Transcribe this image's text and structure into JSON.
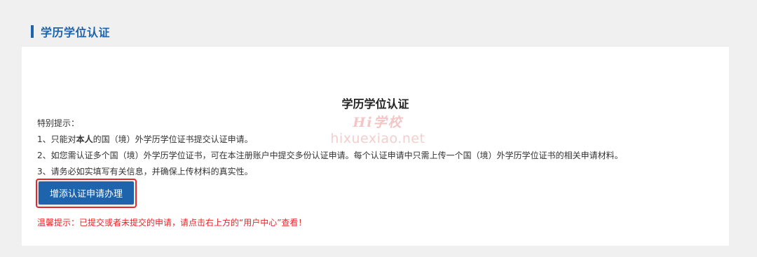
{
  "section": {
    "title": "学历学位认证"
  },
  "card": {
    "title": "学历学位认证",
    "watermark": {
      "logo": "Hi学校",
      "site": "hixuexiao.net"
    },
    "tips": {
      "heading": "特别提示：",
      "item1_prefix": "1、只能对",
      "item1_bold": "本人",
      "item1_suffix": "的国（境）外学历学位证书提交认证申请。",
      "item2": "2、如您需认证多个国（境）外学历学位证书，可在本注册账户中提交多份认证申请。每个认证申请中只需上传一个国（境）外学历学位证书的相关申请材料。",
      "item3": "3、请务必如实填写有关信息，并确保上传材料的真实性。"
    },
    "apply_button": "增添认证申请办理",
    "warm_tip": "温馨提示：已提交或者未提交的申请，请点击右上方的“用户中心”查看！"
  },
  "colors": {
    "primary": "#1d64ad",
    "warning": "#e8252a",
    "background": "#f0f0f0",
    "card": "#ffffff"
  }
}
